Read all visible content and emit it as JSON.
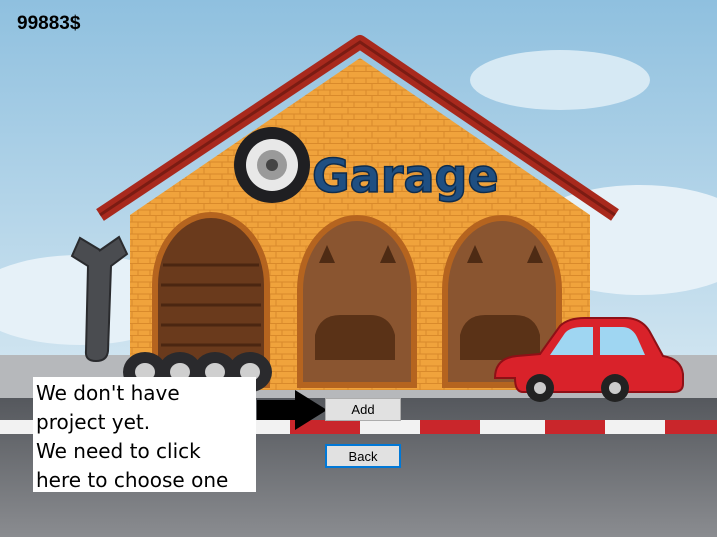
{
  "hud": {
    "money": "99883$"
  },
  "sign": {
    "title": "Garage"
  },
  "tutorial": {
    "lines": [
      "We don't have",
      "project yet.",
      "We need to click",
      "here to choose one"
    ]
  },
  "buttons": {
    "add_label": "Add",
    "back_label": "Back"
  },
  "colors": {
    "sky": "#a9cfe6",
    "road": "#6f7175",
    "brick": "#f0a33c",
    "roof": "#a8291d",
    "car": "#d9222a",
    "button_face": "#e1e1e1",
    "focus_border": "#0078d7"
  }
}
